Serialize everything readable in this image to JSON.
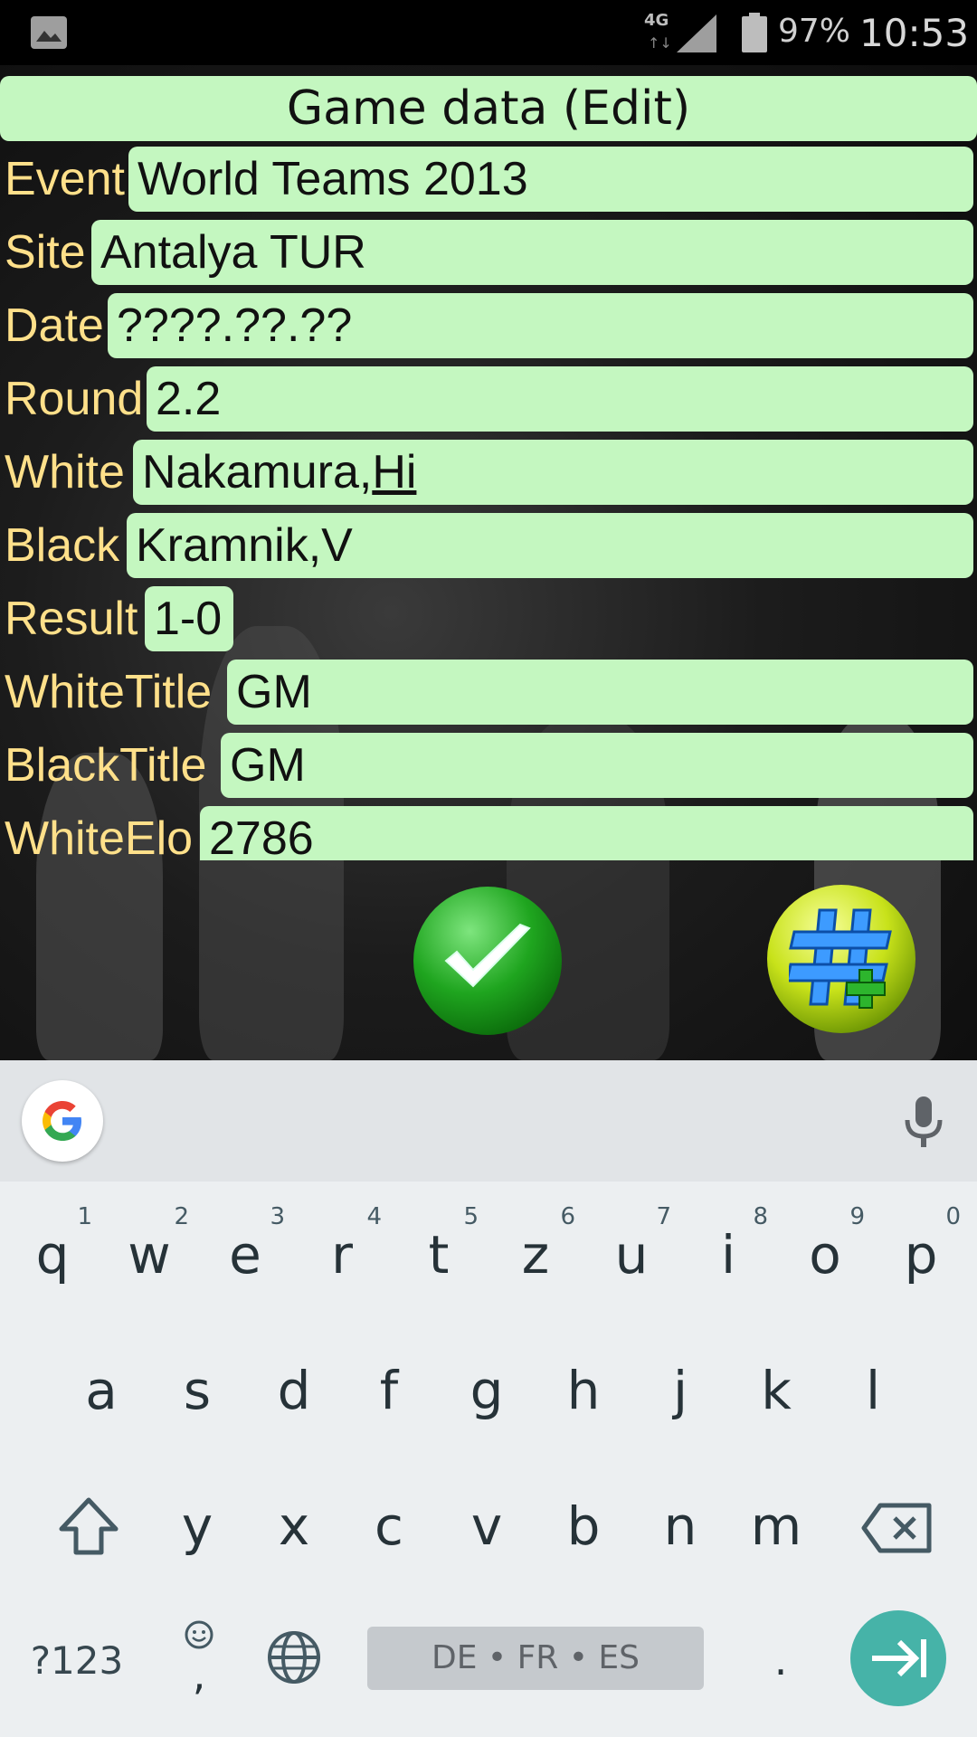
{
  "status": {
    "network": "4G",
    "battery_pct": "97%",
    "time": "10:53"
  },
  "dialog": {
    "title": "Game data (Edit)",
    "fields": [
      {
        "label": "Event",
        "value": "World Teams 2013"
      },
      {
        "label": "Site",
        "value": "Antalya TUR"
      },
      {
        "label": "Date",
        "value": "????.??.??"
      },
      {
        "label": "Round",
        "value": "2.2"
      },
      {
        "label": "White",
        "value_prefix": "Nakamura,",
        "value_underlined": "Hi"
      },
      {
        "label": "Black",
        "value": "Kramnik,V"
      },
      {
        "label": "Result",
        "value": "1-0"
      },
      {
        "label": "WhiteTitle",
        "value": "GM"
      },
      {
        "label": "BlackTitle",
        "value": "GM"
      },
      {
        "label": "WhiteElo",
        "value": "2786"
      }
    ],
    "ok_icon": "checkmark-icon",
    "add_tag_icon": "hash-plus-icon"
  },
  "keyboard": {
    "row1": [
      {
        "key": "q",
        "hint": "1"
      },
      {
        "key": "w",
        "hint": "2"
      },
      {
        "key": "e",
        "hint": "3"
      },
      {
        "key": "r",
        "hint": "4"
      },
      {
        "key": "t",
        "hint": "5"
      },
      {
        "key": "z",
        "hint": "6"
      },
      {
        "key": "u",
        "hint": "7"
      },
      {
        "key": "i",
        "hint": "8"
      },
      {
        "key": "o",
        "hint": "9"
      },
      {
        "key": "p",
        "hint": "0"
      }
    ],
    "row2": [
      "a",
      "s",
      "d",
      "f",
      "g",
      "h",
      "j",
      "k",
      "l"
    ],
    "row3": [
      "y",
      "x",
      "c",
      "v",
      "b",
      "n",
      "m"
    ],
    "symbols_key": "?123",
    "comma_key": ",",
    "period_key": ".",
    "space_label": "DE • FR • ES"
  }
}
